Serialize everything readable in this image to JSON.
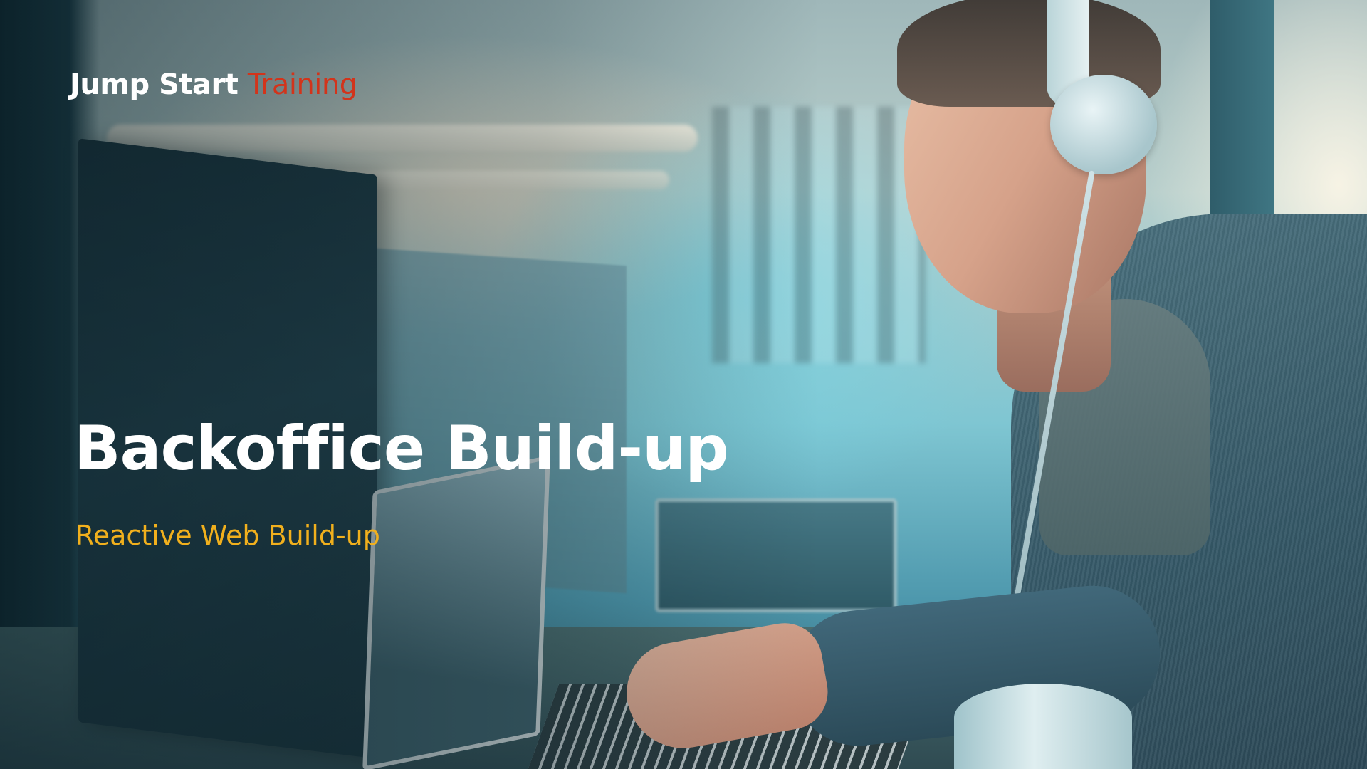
{
  "brand": {
    "name_part1": "Jump Start",
    "name_part2": "Training",
    "accent_color": "#d2341b"
  },
  "slide": {
    "title": "Backoffice Build-up",
    "subtitle": "Reactive Web Build-up",
    "subtitle_color": "#f1b01d"
  }
}
